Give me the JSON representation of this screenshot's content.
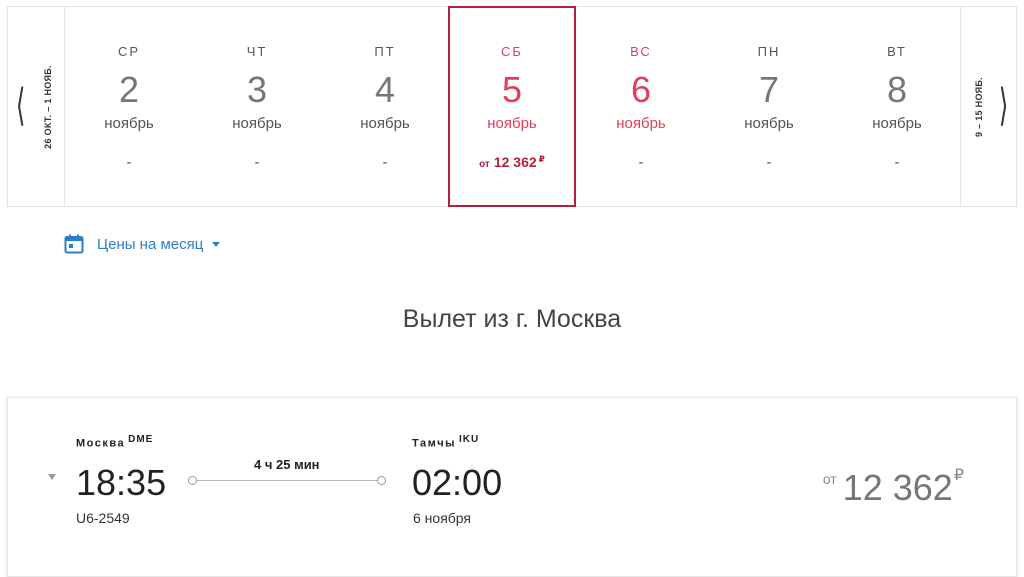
{
  "nav": {
    "prev_range": "26 ОКТ. – 1 НОЯБ.",
    "next_range": "9 – 15 НОЯБ."
  },
  "days": [
    {
      "dow": "СР",
      "num": "2",
      "month": "ноябрь",
      "price": "-"
    },
    {
      "dow": "ЧТ",
      "num": "3",
      "month": "ноябрь",
      "price": "-"
    },
    {
      "dow": "ПТ",
      "num": "4",
      "month": "ноябрь",
      "price": "-"
    },
    {
      "dow": "СБ",
      "num": "5",
      "month": "ноябрь",
      "price_from": "от",
      "price": "12 362",
      "currency": "₽"
    },
    {
      "dow": "ВС",
      "num": "6",
      "month": "ноябрь",
      "price": "-"
    },
    {
      "dow": "ПН",
      "num": "7",
      "month": "ноябрь",
      "price": "-"
    },
    {
      "dow": "ВТ",
      "num": "8",
      "month": "ноябрь",
      "price": "-"
    }
  ],
  "month_prices": {
    "label": "Цены на месяц"
  },
  "section_title": "Вылет из г. Москва",
  "flight": {
    "origin_city": "Москва",
    "origin_code": "DME",
    "dep_time": "18:35",
    "flight_no": "U6-2549",
    "duration": "4 ч 25 мин",
    "dest_city": "Тамчы",
    "dest_code": "IKU",
    "arr_time": "02:00",
    "arr_date": "6 ноября",
    "fare_from": "от",
    "fare": "12 362",
    "currency": "₽"
  },
  "colors": {
    "accent": "#b3213f",
    "weekend": "#e03e5b",
    "link": "#2c7fc4"
  }
}
